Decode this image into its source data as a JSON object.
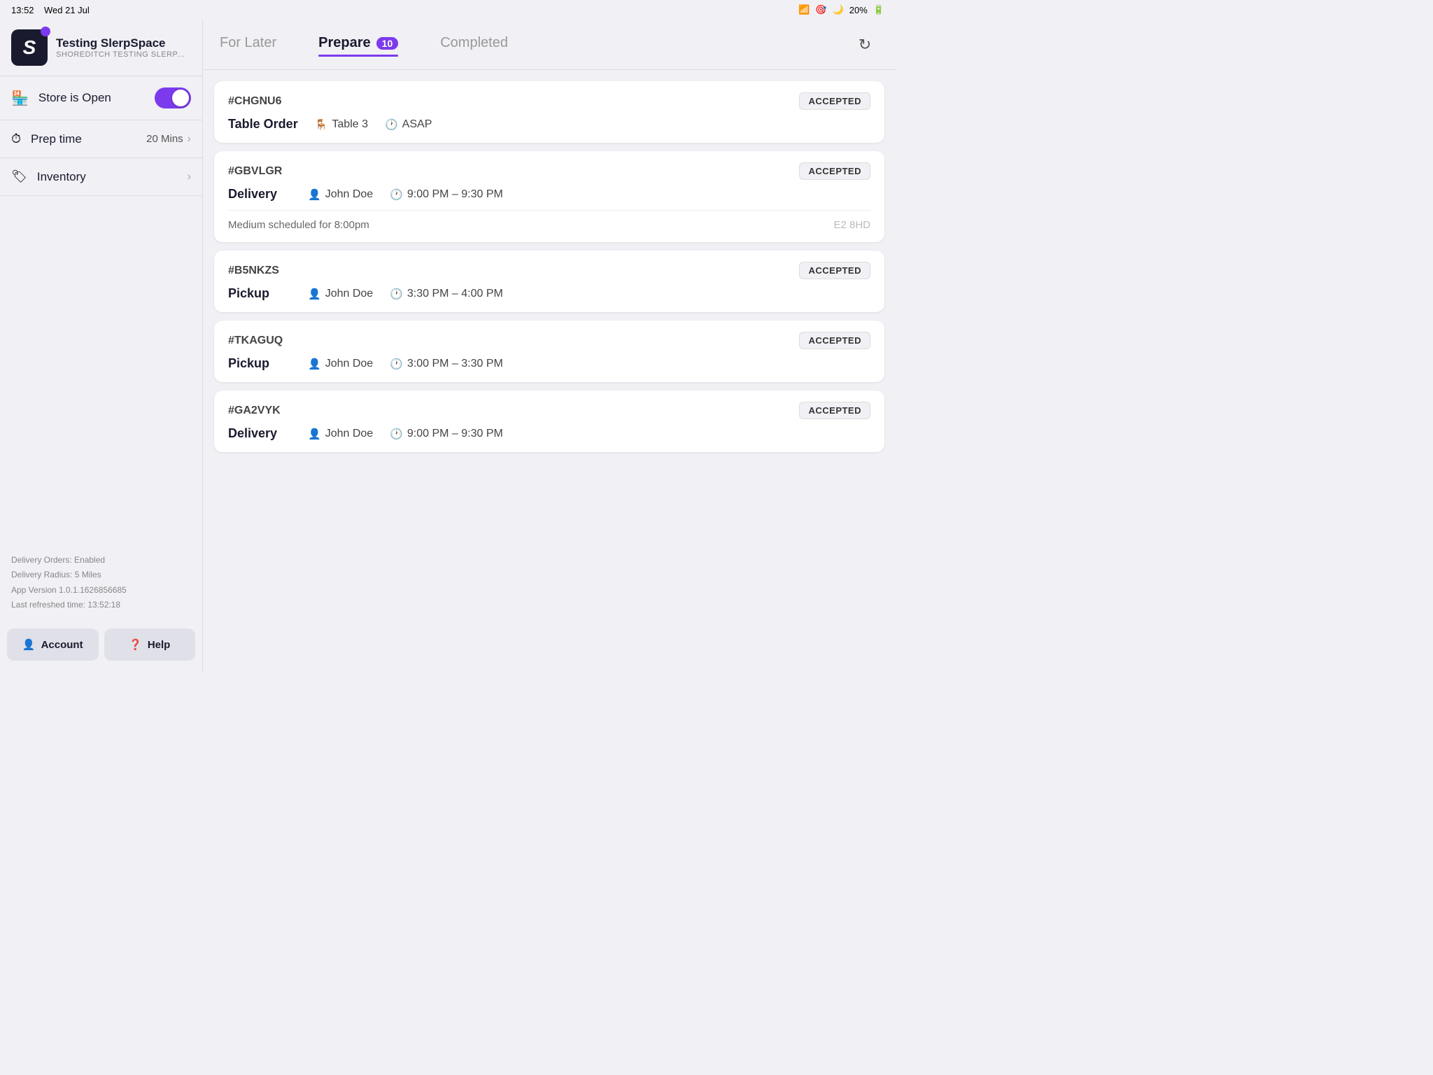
{
  "statusBar": {
    "time": "13:52",
    "date": "Wed 21 Jul",
    "battery": "20%"
  },
  "brand": {
    "name": "Testing SlerpSpace",
    "subtitle": "SHOREDITCH TESTING SLERP...",
    "logoLetter": "S"
  },
  "sidebar": {
    "storeLabel": "Store is Open",
    "prepTimeLabel": "Prep time",
    "prepTimeValue": "20 Mins",
    "inventoryLabel": "Inventory",
    "deliveryOrders": "Delivery Orders: Enabled",
    "deliveryRadius": "Delivery Radius: 5 Miles",
    "appVersion": "App Version 1.0.1.1626856685",
    "lastRefreshed": "Last refreshed time: 13:52:18",
    "accountLabel": "Account",
    "helpLabel": "Help"
  },
  "tabs": [
    {
      "label": "For Later",
      "active": false,
      "badge": null
    },
    {
      "label": "Prepare",
      "active": true,
      "badge": "10"
    },
    {
      "label": "Completed",
      "active": false,
      "badge": null
    }
  ],
  "orders": [
    {
      "id": "#CHGNU6",
      "type": "Table Order",
      "status": "ACCEPTED",
      "details": [
        {
          "icon": "table",
          "text": "Table 3"
        },
        {
          "icon": "clock",
          "text": "ASAP"
        }
      ],
      "hasExtra": false
    },
    {
      "id": "#GBVLGR",
      "type": "Delivery",
      "status": "ACCEPTED",
      "details": [
        {
          "icon": "person",
          "text": "John Doe"
        },
        {
          "icon": "clock",
          "text": "9:00 PM – 9:30 PM"
        }
      ],
      "hasExtra": true,
      "note": "Medium scheduled for 8:00pm",
      "postcode": "E2 8HD"
    },
    {
      "id": "#B5NKZS",
      "type": "Pickup",
      "status": "ACCEPTED",
      "details": [
        {
          "icon": "person",
          "text": "John Doe"
        },
        {
          "icon": "clock",
          "text": "3:30 PM – 4:00 PM"
        }
      ],
      "hasExtra": false
    },
    {
      "id": "#TKAGUQ",
      "type": "Pickup",
      "status": "ACCEPTED",
      "details": [
        {
          "icon": "person",
          "text": "John Doe"
        },
        {
          "icon": "clock",
          "text": "3:00 PM – 3:30 PM"
        }
      ],
      "hasExtra": false
    },
    {
      "id": "#GA2VYK",
      "type": "Delivery",
      "status": "ACCEPTED",
      "details": [
        {
          "icon": "person",
          "text": "John Doe"
        },
        {
          "icon": "clock",
          "text": "9:00 PM – 9:30 PM"
        }
      ],
      "hasExtra": false
    }
  ]
}
